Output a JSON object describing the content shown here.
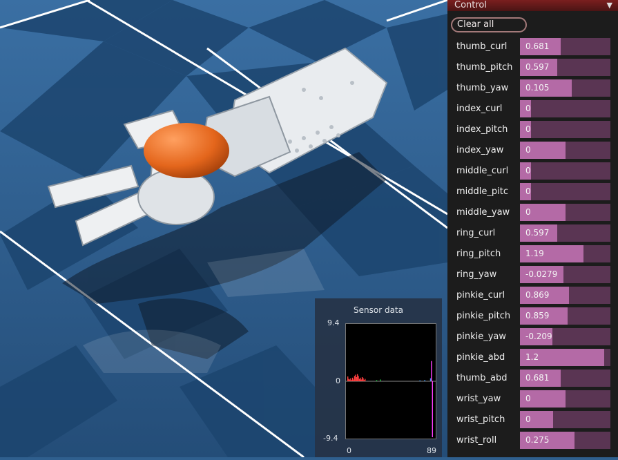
{
  "panel": {
    "title": "Control",
    "collapse_icon": "triangle-down-icon",
    "clear_label": "Clear all",
    "sliders": [
      {
        "name": "thumb_curl",
        "value": "0.681",
        "fill": 0.45
      },
      {
        "name": "thumb_pitch",
        "value": "0.597",
        "fill": 0.41
      },
      {
        "name": "thumb_yaw",
        "value": "0.105",
        "fill": 0.57
      },
      {
        "name": "index_curl",
        "value": "0",
        "fill": 0.12
      },
      {
        "name": "index_pitch",
        "value": "0",
        "fill": 0.12
      },
      {
        "name": "index_yaw",
        "value": "0",
        "fill": 0.5
      },
      {
        "name": "middle_curl",
        "value": "0",
        "fill": 0.12
      },
      {
        "name": "middle_pitc",
        "value": "0",
        "fill": 0.12
      },
      {
        "name": "middle_yaw",
        "value": "0",
        "fill": 0.5
      },
      {
        "name": "ring_curl",
        "value": "0.597",
        "fill": 0.41
      },
      {
        "name": "ring_pitch",
        "value": "1.19",
        "fill": 0.7
      },
      {
        "name": "ring_yaw",
        "value": "-0.0279",
        "fill": 0.48
      },
      {
        "name": "pinkie_curl",
        "value": "0.869",
        "fill": 0.54
      },
      {
        "name": "pinkie_pitch",
        "value": "0.859",
        "fill": 0.53
      },
      {
        "name": "pinkie_yaw",
        "value": "-0.209",
        "fill": 0.36
      },
      {
        "name": "pinkie_abd",
        "value": "1.2",
        "fill": 0.93
      },
      {
        "name": "thumb_abd",
        "value": "0.681",
        "fill": 0.45
      },
      {
        "name": "wrist_yaw",
        "value": "0",
        "fill": 0.5
      },
      {
        "name": "wrist_pitch",
        "value": "0",
        "fill": 0.37
      },
      {
        "name": "wrist_roll",
        "value": "0.275",
        "fill": 0.6
      }
    ]
  },
  "sensor": {
    "title": "Sensor data",
    "y_max": "9.4",
    "y_zero": "0",
    "y_min": "-9.4",
    "x_min": "0",
    "x_max": "89",
    "colors": {
      "red": "#ff4040",
      "green": "#20c040",
      "blue": "#40a0ff",
      "magenta": "#ff40ff"
    }
  },
  "chart_data": {
    "type": "bar",
    "title": "Sensor data",
    "xlim": [
      0,
      89
    ],
    "ylim": [
      -9.4,
      9.4
    ],
    "series": [
      {
        "color": "#ff4040",
        "x": [
          0,
          1,
          2,
          3,
          4,
          5,
          6,
          7,
          8,
          9,
          10,
          11,
          12,
          13,
          14,
          15,
          16,
          17,
          18
        ],
        "values": [
          0.8,
          0.4,
          0.3,
          0.5,
          0.2,
          0.6,
          0.3,
          0.9,
          1.1,
          0.7,
          1.2,
          0.9,
          0.4,
          0.6,
          0.3,
          0.7,
          0.5,
          0.2,
          0.4
        ]
      },
      {
        "color": "#20c040",
        "x": [
          30,
          34
        ],
        "values": [
          0.2,
          0.3
        ]
      },
      {
        "color": "#40a0ff",
        "x": [
          75,
          80,
          86
        ],
        "values": [
          0.15,
          0.2,
          0.5
        ]
      },
      {
        "color": "#ff40ff",
        "x": [
          87,
          88
        ],
        "values": [
          3.4,
          -9.4
        ]
      }
    ]
  }
}
